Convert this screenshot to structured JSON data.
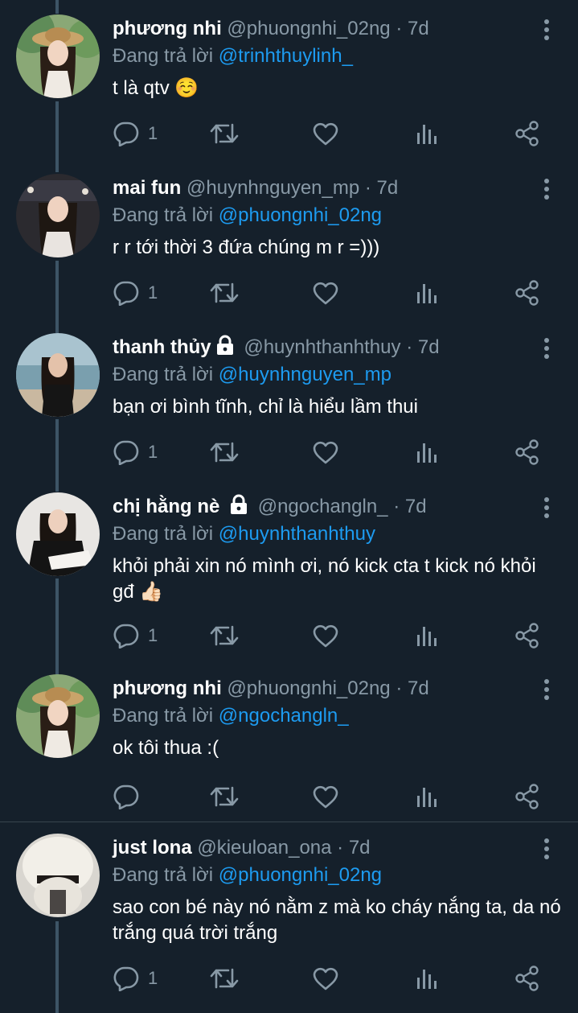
{
  "reply_prefix": "Đang trả lời",
  "colors": {
    "background": "#15202b",
    "secondary_text": "#8899a6",
    "mention": "#1d9bf0",
    "thread_line": "#3d5466"
  },
  "tweets": [
    {
      "name": "phương nhi",
      "handle": "@phuongnhi_02ng",
      "time": "· 7d",
      "reply_to": "@trinhthuylinh_",
      "text": "t là qtv ☺️",
      "reply_count": "1",
      "locked": false
    },
    {
      "name": "mai fun",
      "handle": "@huynhnguyen_mp",
      "time": "· 7d",
      "reply_to": "@phuongnhi_02ng",
      "text": "r r tới thời 3 đứa chúng m r =)))",
      "reply_count": "1",
      "locked": false
    },
    {
      "name": "thanh thủy",
      "handle": "@huynhthanhthuy",
      "time": "· 7d",
      "reply_to": "@huynhnguyen_mp",
      "text": "bạn ơi bình tĩnh, chỉ là hiểu lầm thui",
      "reply_count": "1",
      "locked": true
    },
    {
      "name": "chị hằng nè",
      "handle": "@ngochangln_",
      "time": "· 7d",
      "reply_to": "@huynhthanhthuy",
      "text": "khỏi phải xin nó mình ơi, nó kick cta t kick nó khỏi gđ 👍🏻",
      "reply_count": "1",
      "locked": true
    },
    {
      "name": "phương nhi",
      "handle": "@phuongnhi_02ng",
      "time": "· 7d",
      "reply_to": "@ngochangln_",
      "text": "ok tôi thua :(",
      "reply_count": "",
      "locked": false
    },
    {
      "name": "just lona",
      "handle": "@kieuloan_ona",
      "time": "· 7d",
      "reply_to": "@phuongnhi_02ng",
      "text": "sao con bé này nó nằm z mà ko cháy nắng ta, da nó trắng quá trời trắng",
      "reply_count": "1",
      "locked": false
    }
  ]
}
